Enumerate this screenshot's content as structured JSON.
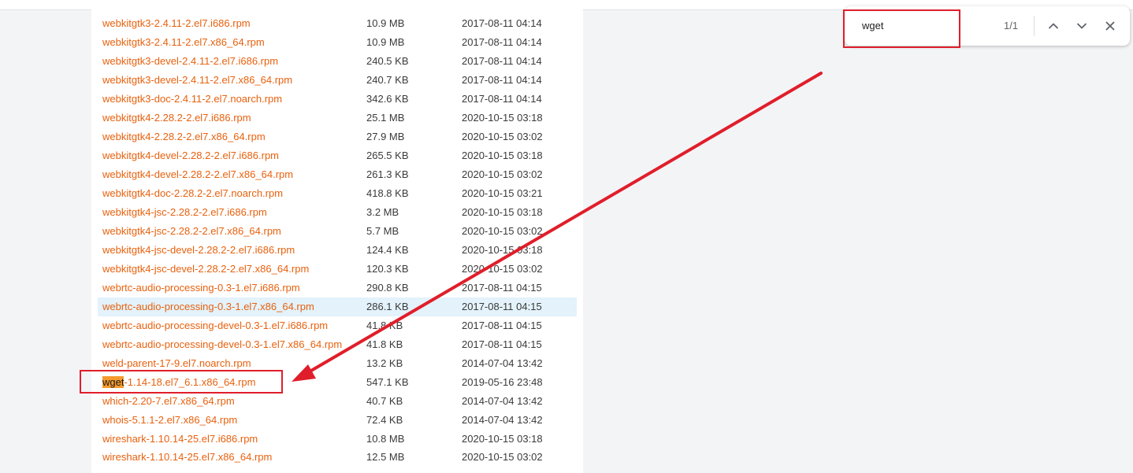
{
  "find_bar": {
    "query": "wget",
    "match_count": "1/1"
  },
  "files": [
    {
      "name": "webkitgtk3-2.4.11-2.el7.i686.rpm",
      "size": "10.9 MB",
      "date": "2017-08-11 04:14"
    },
    {
      "name": "webkitgtk3-2.4.11-2.el7.x86_64.rpm",
      "size": "10.9 MB",
      "date": "2017-08-11 04:14"
    },
    {
      "name": "webkitgtk3-devel-2.4.11-2.el7.i686.rpm",
      "size": "240.5 KB",
      "date": "2017-08-11 04:14"
    },
    {
      "name": "webkitgtk3-devel-2.4.11-2.el7.x86_64.rpm",
      "size": "240.7 KB",
      "date": "2017-08-11 04:14"
    },
    {
      "name": "webkitgtk3-doc-2.4.11-2.el7.noarch.rpm",
      "size": "342.6 KB",
      "date": "2017-08-11 04:14"
    },
    {
      "name": "webkitgtk4-2.28.2-2.el7.i686.rpm",
      "size": "25.1 MB",
      "date": "2020-10-15 03:18"
    },
    {
      "name": "webkitgtk4-2.28.2-2.el7.x86_64.rpm",
      "size": "27.9 MB",
      "date": "2020-10-15 03:02"
    },
    {
      "name": "webkitgtk4-devel-2.28.2-2.el7.i686.rpm",
      "size": "265.5 KB",
      "date": "2020-10-15 03:18"
    },
    {
      "name": "webkitgtk4-devel-2.28.2-2.el7.x86_64.rpm",
      "size": "261.3 KB",
      "date": "2020-10-15 03:02"
    },
    {
      "name": "webkitgtk4-doc-2.28.2-2.el7.noarch.rpm",
      "size": "418.8 KB",
      "date": "2020-10-15 03:21"
    },
    {
      "name": "webkitgtk4-jsc-2.28.2-2.el7.i686.rpm",
      "size": "3.2 MB",
      "date": "2020-10-15 03:18"
    },
    {
      "name": "webkitgtk4-jsc-2.28.2-2.el7.x86_64.rpm",
      "size": "5.7 MB",
      "date": "2020-10-15 03:02"
    },
    {
      "name": "webkitgtk4-jsc-devel-2.28.2-2.el7.i686.rpm",
      "size": "124.4 KB",
      "date": "2020-10-15 03:18"
    },
    {
      "name": "webkitgtk4-jsc-devel-2.28.2-2.el7.x86_64.rpm",
      "size": "120.3 KB",
      "date": "2020-10-15 03:02"
    },
    {
      "name": "webrtc-audio-processing-0.3-1.el7.i686.rpm",
      "size": "290.8 KB",
      "date": "2017-08-11 04:15"
    },
    {
      "name": "webrtc-audio-processing-0.3-1.el7.x86_64.rpm",
      "size": "286.1 KB",
      "date": "2017-08-11 04:15"
    },
    {
      "name": "webrtc-audio-processing-devel-0.3-1.el7.i686.rpm",
      "size": "41.8 KB",
      "date": "2017-08-11 04:15"
    },
    {
      "name": "webrtc-audio-processing-devel-0.3-1.el7.x86_64.rpm",
      "size": "41.8 KB",
      "date": "2017-08-11 04:15"
    },
    {
      "name": "weld-parent-17-9.el7.noarch.rpm",
      "size": "13.2 KB",
      "date": "2014-07-04 13:42"
    },
    {
      "name_match": "wget",
      "name_rest": "-1.14-18.el7_6.1.x86_64.rpm",
      "size": "547.1 KB",
      "date": "2019-05-16 23:48"
    },
    {
      "name": "which-2.20-7.el7.x86_64.rpm",
      "size": "40.7 KB",
      "date": "2014-07-04 13:42"
    },
    {
      "name": "whois-5.1.1-2.el7.x86_64.rpm",
      "size": "72.4 KB",
      "date": "2014-07-04 13:42"
    },
    {
      "name": "wireshark-1.10.14-25.el7.i686.rpm",
      "size": "10.8 MB",
      "date": "2020-10-15 03:18"
    },
    {
      "name": "wireshark-1.10.14-25.el7.x86_64.rpm",
      "size": "12.5 MB",
      "date": "2020-10-15 03:02"
    }
  ],
  "colors": {
    "link": "#e8610e",
    "row_highlight": "#e3f2fb",
    "find_match": "#f59b2d",
    "annotation": "#e01e2b"
  }
}
